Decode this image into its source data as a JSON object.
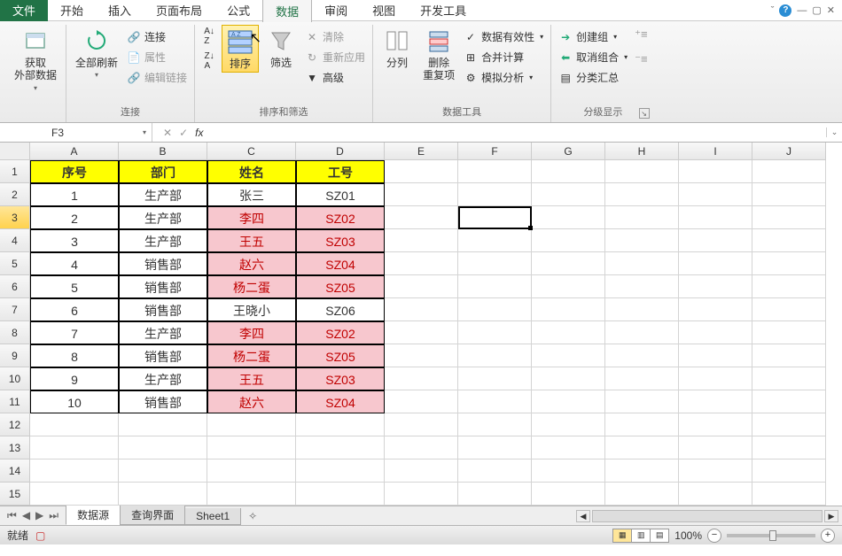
{
  "tabs": {
    "file": "文件",
    "home": "开始",
    "insert": "插入",
    "layout": "页面布局",
    "formulas": "公式",
    "data": "数据",
    "review": "审阅",
    "view": "视图",
    "dev": "开发工具"
  },
  "ribbon": {
    "get_ext": "获取\n外部数据",
    "refresh": "全部刷新",
    "conn": "连接",
    "props": "属性",
    "editlinks": "编辑链接",
    "group_conn": "连接",
    "sort_asc": "A↓Z",
    "sort_desc": "Z↓A",
    "sort": "排序",
    "filter": "筛选",
    "clear": "清除",
    "reapply": "重新应用",
    "advanced": "高级",
    "group_sort": "排序和筛选",
    "texttocol": "分列",
    "dedup": "删除\n重复项",
    "validation": "数据有效性",
    "consolidate": "合并计算",
    "whatif": "模拟分析",
    "group_tools": "数据工具",
    "groupbtn": "创建组",
    "ungroup": "取消组合",
    "subtotal": "分类汇总",
    "group_outline": "分级显示"
  },
  "namebox": "F3",
  "columns": [
    "A",
    "B",
    "C",
    "D",
    "E",
    "F",
    "G",
    "H",
    "I",
    "J"
  ],
  "table": {
    "headers": [
      "序号",
      "部门",
      "姓名",
      "工号"
    ],
    "rows": [
      {
        "seq": "1",
        "dept": "生产部",
        "name": "张三",
        "code": "SZ01",
        "hl": false
      },
      {
        "seq": "2",
        "dept": "生产部",
        "name": "李四",
        "code": "SZ02",
        "hl": true
      },
      {
        "seq": "3",
        "dept": "生产部",
        "name": "王五",
        "code": "SZ03",
        "hl": true
      },
      {
        "seq": "4",
        "dept": "销售部",
        "name": "赵六",
        "code": "SZ04",
        "hl": true
      },
      {
        "seq": "5",
        "dept": "销售部",
        "name": "杨二蛋",
        "code": "SZ05",
        "hl": true
      },
      {
        "seq": "6",
        "dept": "销售部",
        "name": "王晓小",
        "code": "SZ06",
        "hl": false
      },
      {
        "seq": "7",
        "dept": "生产部",
        "name": "李四",
        "code": "SZ02",
        "hl": true
      },
      {
        "seq": "8",
        "dept": "销售部",
        "name": "杨二蛋",
        "code": "SZ05",
        "hl": true
      },
      {
        "seq": "9",
        "dept": "生产部",
        "name": "王五",
        "code": "SZ03",
        "hl": true
      },
      {
        "seq": "10",
        "dept": "销售部",
        "name": "赵六",
        "code": "SZ04",
        "hl": true
      }
    ]
  },
  "sheets": [
    "数据源",
    "查询界面",
    "Sheet1"
  ],
  "active_sheet": 0,
  "active_cell": "F3",
  "selected_row": 3,
  "status": "就绪",
  "zoom": "100%"
}
